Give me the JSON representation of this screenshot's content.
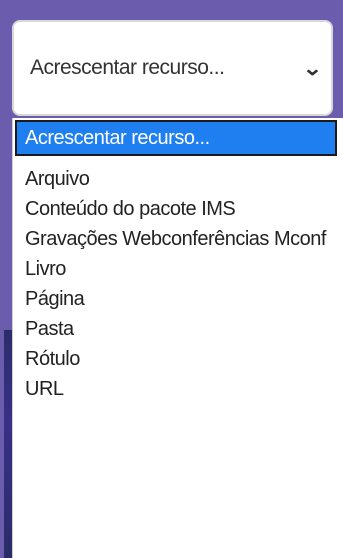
{
  "select": {
    "value": "Acrescentar recurso...",
    "chevron": "⌄"
  },
  "dropdown": {
    "options": [
      {
        "label": "Acrescentar recurso...",
        "selected": true
      },
      {
        "label": "Arquivo",
        "selected": false
      },
      {
        "label": "Conteúdo do pacote IMS",
        "selected": false
      },
      {
        "label": "Gravações Webconferências Mconf",
        "selected": false
      },
      {
        "label": "Livro",
        "selected": false
      },
      {
        "label": "Página",
        "selected": false
      },
      {
        "label": "Pasta",
        "selected": false
      },
      {
        "label": "Rótulo",
        "selected": false
      },
      {
        "label": "URL",
        "selected": false
      }
    ]
  },
  "colors": {
    "background": "#6b5cad",
    "highlight": "#1f7ef0",
    "text": "#222222"
  },
  "icons": {
    "chevron": "chevron-down-icon"
  }
}
